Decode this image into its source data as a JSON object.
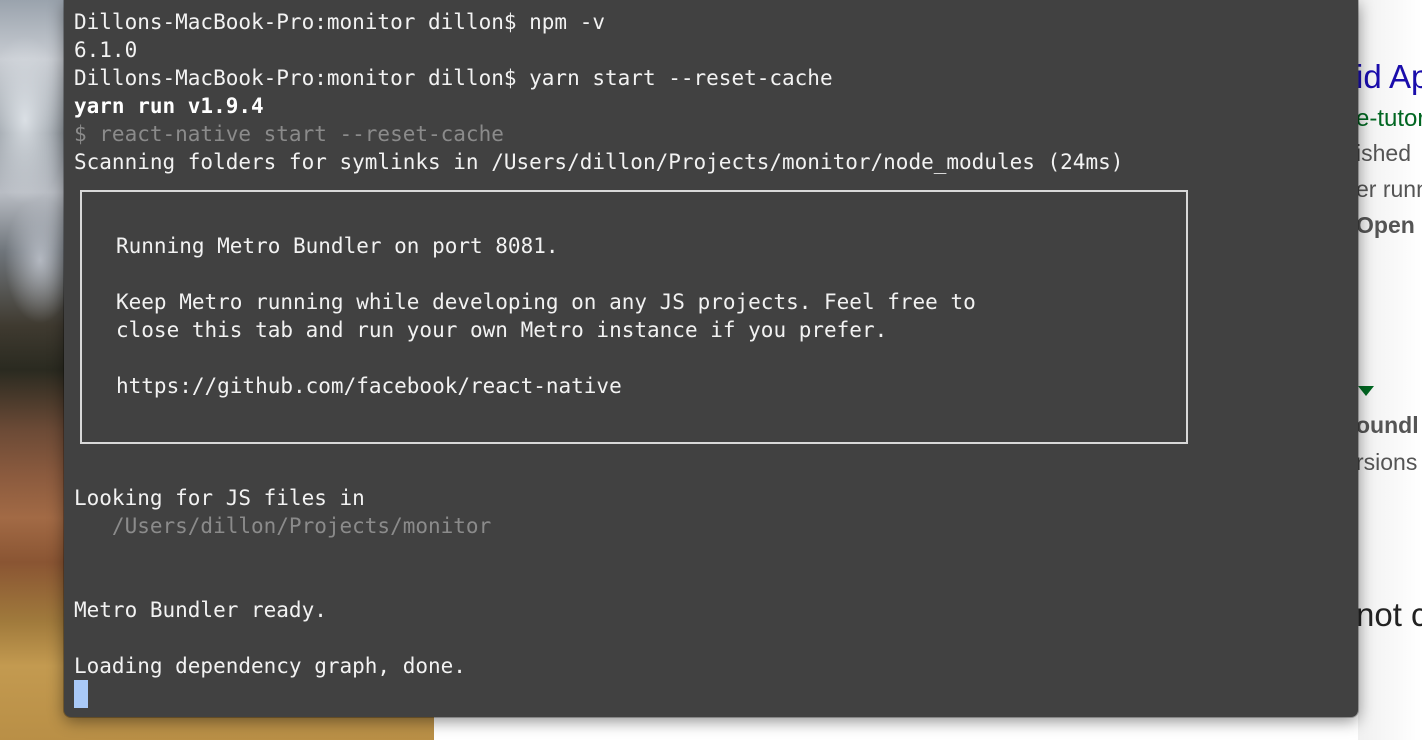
{
  "terminal": {
    "lines": [
      "Dillons-MacBook-Pro:monitor dillon$ npm -v",
      "6.1.0",
      "Dillons-MacBook-Pro:monitor dillon$ yarn start --reset-cache",
      "yarn run v1.9.4",
      "$ react-native start --reset-cache",
      "Scanning folders for symlinks in /Users/dillon/Projects/monitor/node_modules (24ms)"
    ],
    "box": {
      "port_line": "Running Metro Bundler on port 8081.",
      "keep_line1": "Keep Metro running while developing on any JS projects. Feel free to",
      "keep_line2": "close this tab and run your own Metro instance if you prefer.",
      "url": "https://github.com/facebook/react-native"
    },
    "looking_line": "Looking for JS files in",
    "looking_path": "   /Users/dillon/Projects/monitor",
    "ready_line": "Metro Bundler ready.",
    "loading_line": "Loading dependency graph, done."
  },
  "browser_fragments": {
    "title": "id Ap",
    "url": "e-tutor",
    "text1": "ished",
    "text2": "er runn",
    "bold": "Open",
    "bold2": "oundl",
    "text3": "rsions",
    "big": "not c"
  },
  "colors": {
    "terminal_bg": "#414141",
    "terminal_text": "#f2f2f2",
    "dim_text": "#8b8b8b",
    "cursor": "#a9c9f7",
    "link_title": "#1a0dab",
    "link_url": "#006621"
  }
}
